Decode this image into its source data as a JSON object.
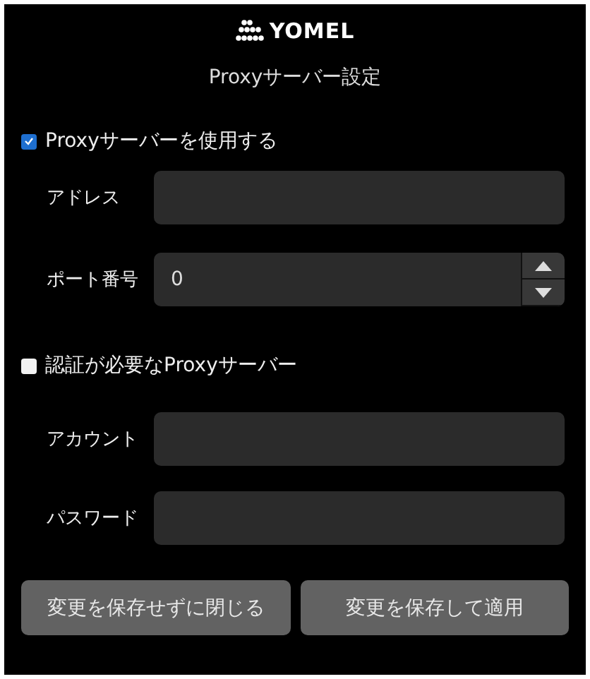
{
  "logo": {
    "text": "YOMEL"
  },
  "title": "Proxyサーバー設定",
  "use_proxy": {
    "label": "Proxyサーバーを使用する",
    "checked": true
  },
  "fields": [
    {
      "label": "アドレス",
      "kind": "text"
    },
    {
      "label": "ポート番号",
      "value": "0",
      "kind": "spin"
    }
  ],
  "auth": {
    "label": "認証が必要なProxyサーバー",
    "checked": false
  },
  "auth_fields": [
    {
      "label": "アカウント"
    },
    {
      "label": "パスワード"
    }
  ],
  "buttons": [
    "変更を保存せずに閉じる",
    "変更を保存して適用"
  ]
}
